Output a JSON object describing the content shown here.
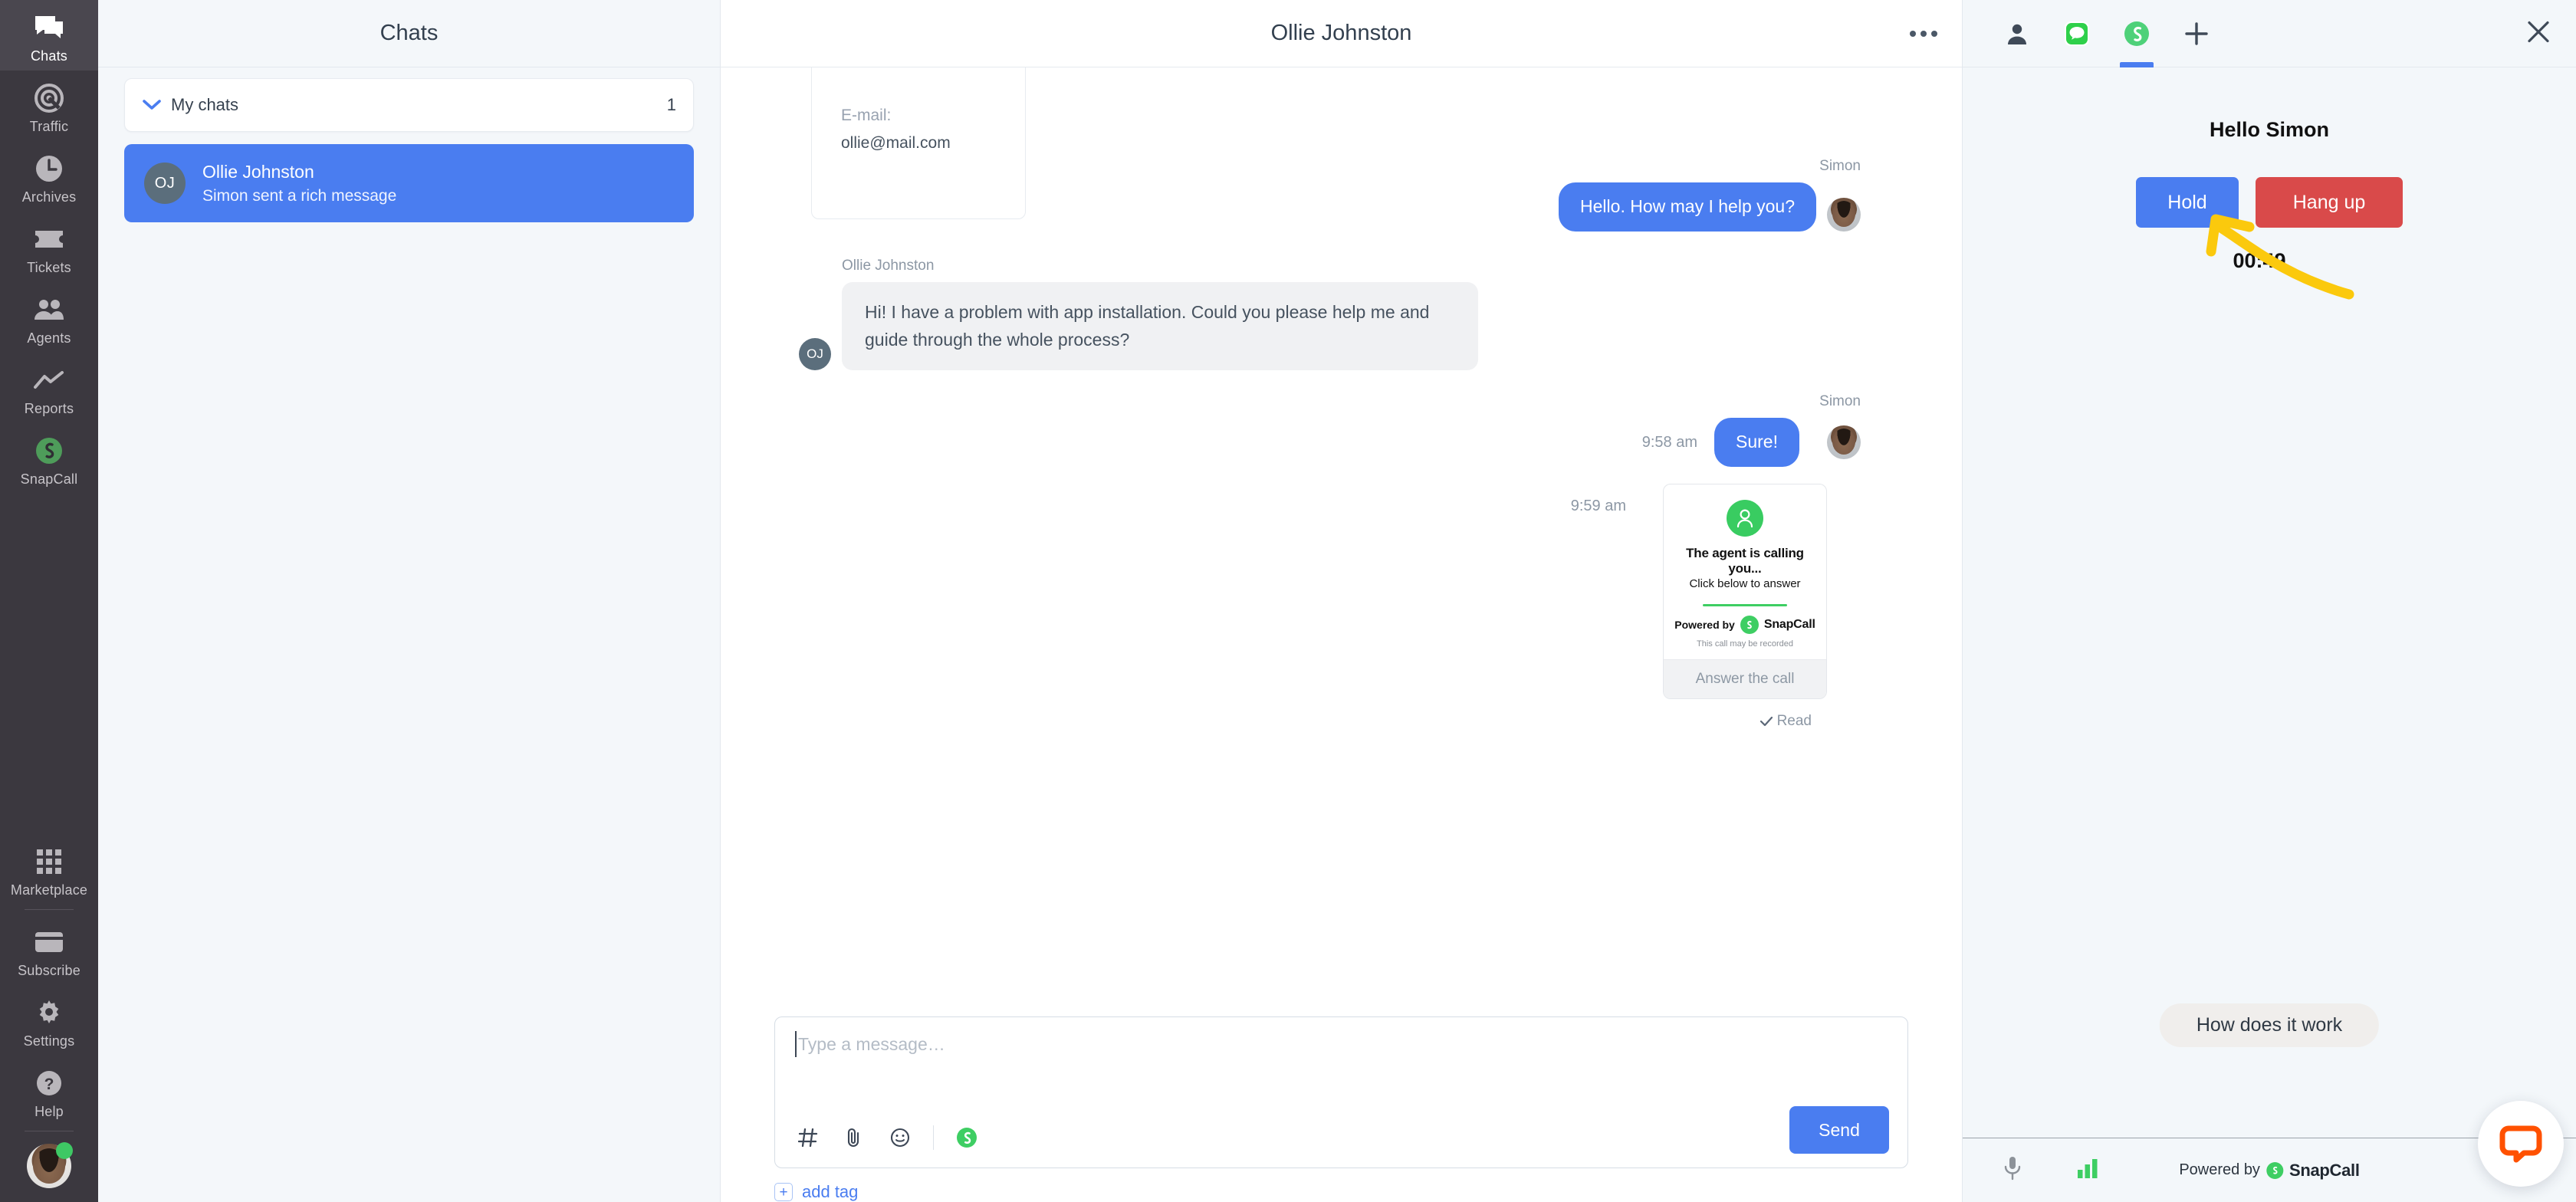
{
  "rail": {
    "items": [
      {
        "label": "Chats",
        "icon": "chats-icon",
        "active": true
      },
      {
        "label": "Traffic",
        "icon": "traffic-icon",
        "active": false
      },
      {
        "label": "Archives",
        "icon": "archives-icon",
        "active": false
      },
      {
        "label": "Tickets",
        "icon": "tickets-icon",
        "active": false
      },
      {
        "label": "Agents",
        "icon": "agents-icon",
        "active": false
      },
      {
        "label": "Reports",
        "icon": "reports-icon",
        "active": false
      },
      {
        "label": "SnapCall",
        "icon": "snapcall-icon",
        "active": false
      }
    ],
    "bottom_items": [
      {
        "label": "Marketplace",
        "icon": "grid-icon"
      },
      {
        "label": "Subscribe",
        "icon": "card-icon"
      },
      {
        "label": "Settings",
        "icon": "gear-icon"
      },
      {
        "label": "Help",
        "icon": "question-icon"
      }
    ],
    "status_color": "#3ec864"
  },
  "chats": {
    "title": "Chats",
    "group": {
      "label": "My chats",
      "count": "1"
    },
    "items": [
      {
        "initials": "OJ",
        "name": "Ollie Johnston",
        "preview": "Simon sent a rich message",
        "selected": true
      }
    ]
  },
  "conversation": {
    "title": "Ollie Johnston",
    "email_card": {
      "label": "E-mail:",
      "value": "ollie@mail.com"
    },
    "messages": [
      {
        "sender": "Simon",
        "side": "right",
        "text": "Hello. How may I help you?",
        "time": ""
      },
      {
        "sender": "Ollie Johnston",
        "side": "left",
        "initials": "OJ",
        "text": "Hi! I have a problem with app installation. Could you please help me and guide through the whole process?",
        "time": ""
      },
      {
        "sender": "Simon",
        "side": "right",
        "text": "Sure!",
        "time": "9:58 am"
      }
    ],
    "rich_card": {
      "time": "9:59 am",
      "headline": "The agent is calling you...",
      "subtext": "Click below to answer",
      "powered_prefix": "Powered by",
      "powered_brand": "SnapCall",
      "note": "This call may be recorded",
      "action": "Answer the call"
    },
    "read_status": "Read",
    "composer": {
      "placeholder": "Type a message…",
      "value": "",
      "send_label": "Send",
      "tools": [
        "hash-icon",
        "attachment-icon",
        "emoji-icon",
        "snapcall-icon"
      ]
    },
    "add_tag_label": "add tag"
  },
  "right_panel": {
    "tabs": [
      {
        "icon": "person-icon",
        "active": false
      },
      {
        "icon": "messages-icon",
        "active": false
      },
      {
        "icon": "snapcall-icon",
        "active": true
      },
      {
        "icon": "plus-icon",
        "active": false
      }
    ],
    "close_icon": "close-icon",
    "greeting": "Hello Simon",
    "hold_label": "Hold",
    "hangup_label": "Hang up",
    "timer": "00:49",
    "how_it_works": "How does it work",
    "footer": {
      "mic_icon": "microphone-icon",
      "signal_icon": "signal-bars-icon",
      "powered_prefix": "Powered by",
      "powered_brand": "SnapCall"
    },
    "annotation": {
      "type": "arrow",
      "color": "#fbc90d",
      "points_to": "hangup_label"
    }
  },
  "widget": {
    "icon": "livechat-bubble-icon",
    "color": "#ff5100"
  },
  "colors": {
    "accent_blue": "#4a7df0",
    "danger_red": "#d94a4a",
    "snapcall_green": "#3ece63",
    "rail_bg": "#3b383f",
    "panel_bg": "#f3f7fa",
    "annotation_yellow": "#fbc90d"
  }
}
